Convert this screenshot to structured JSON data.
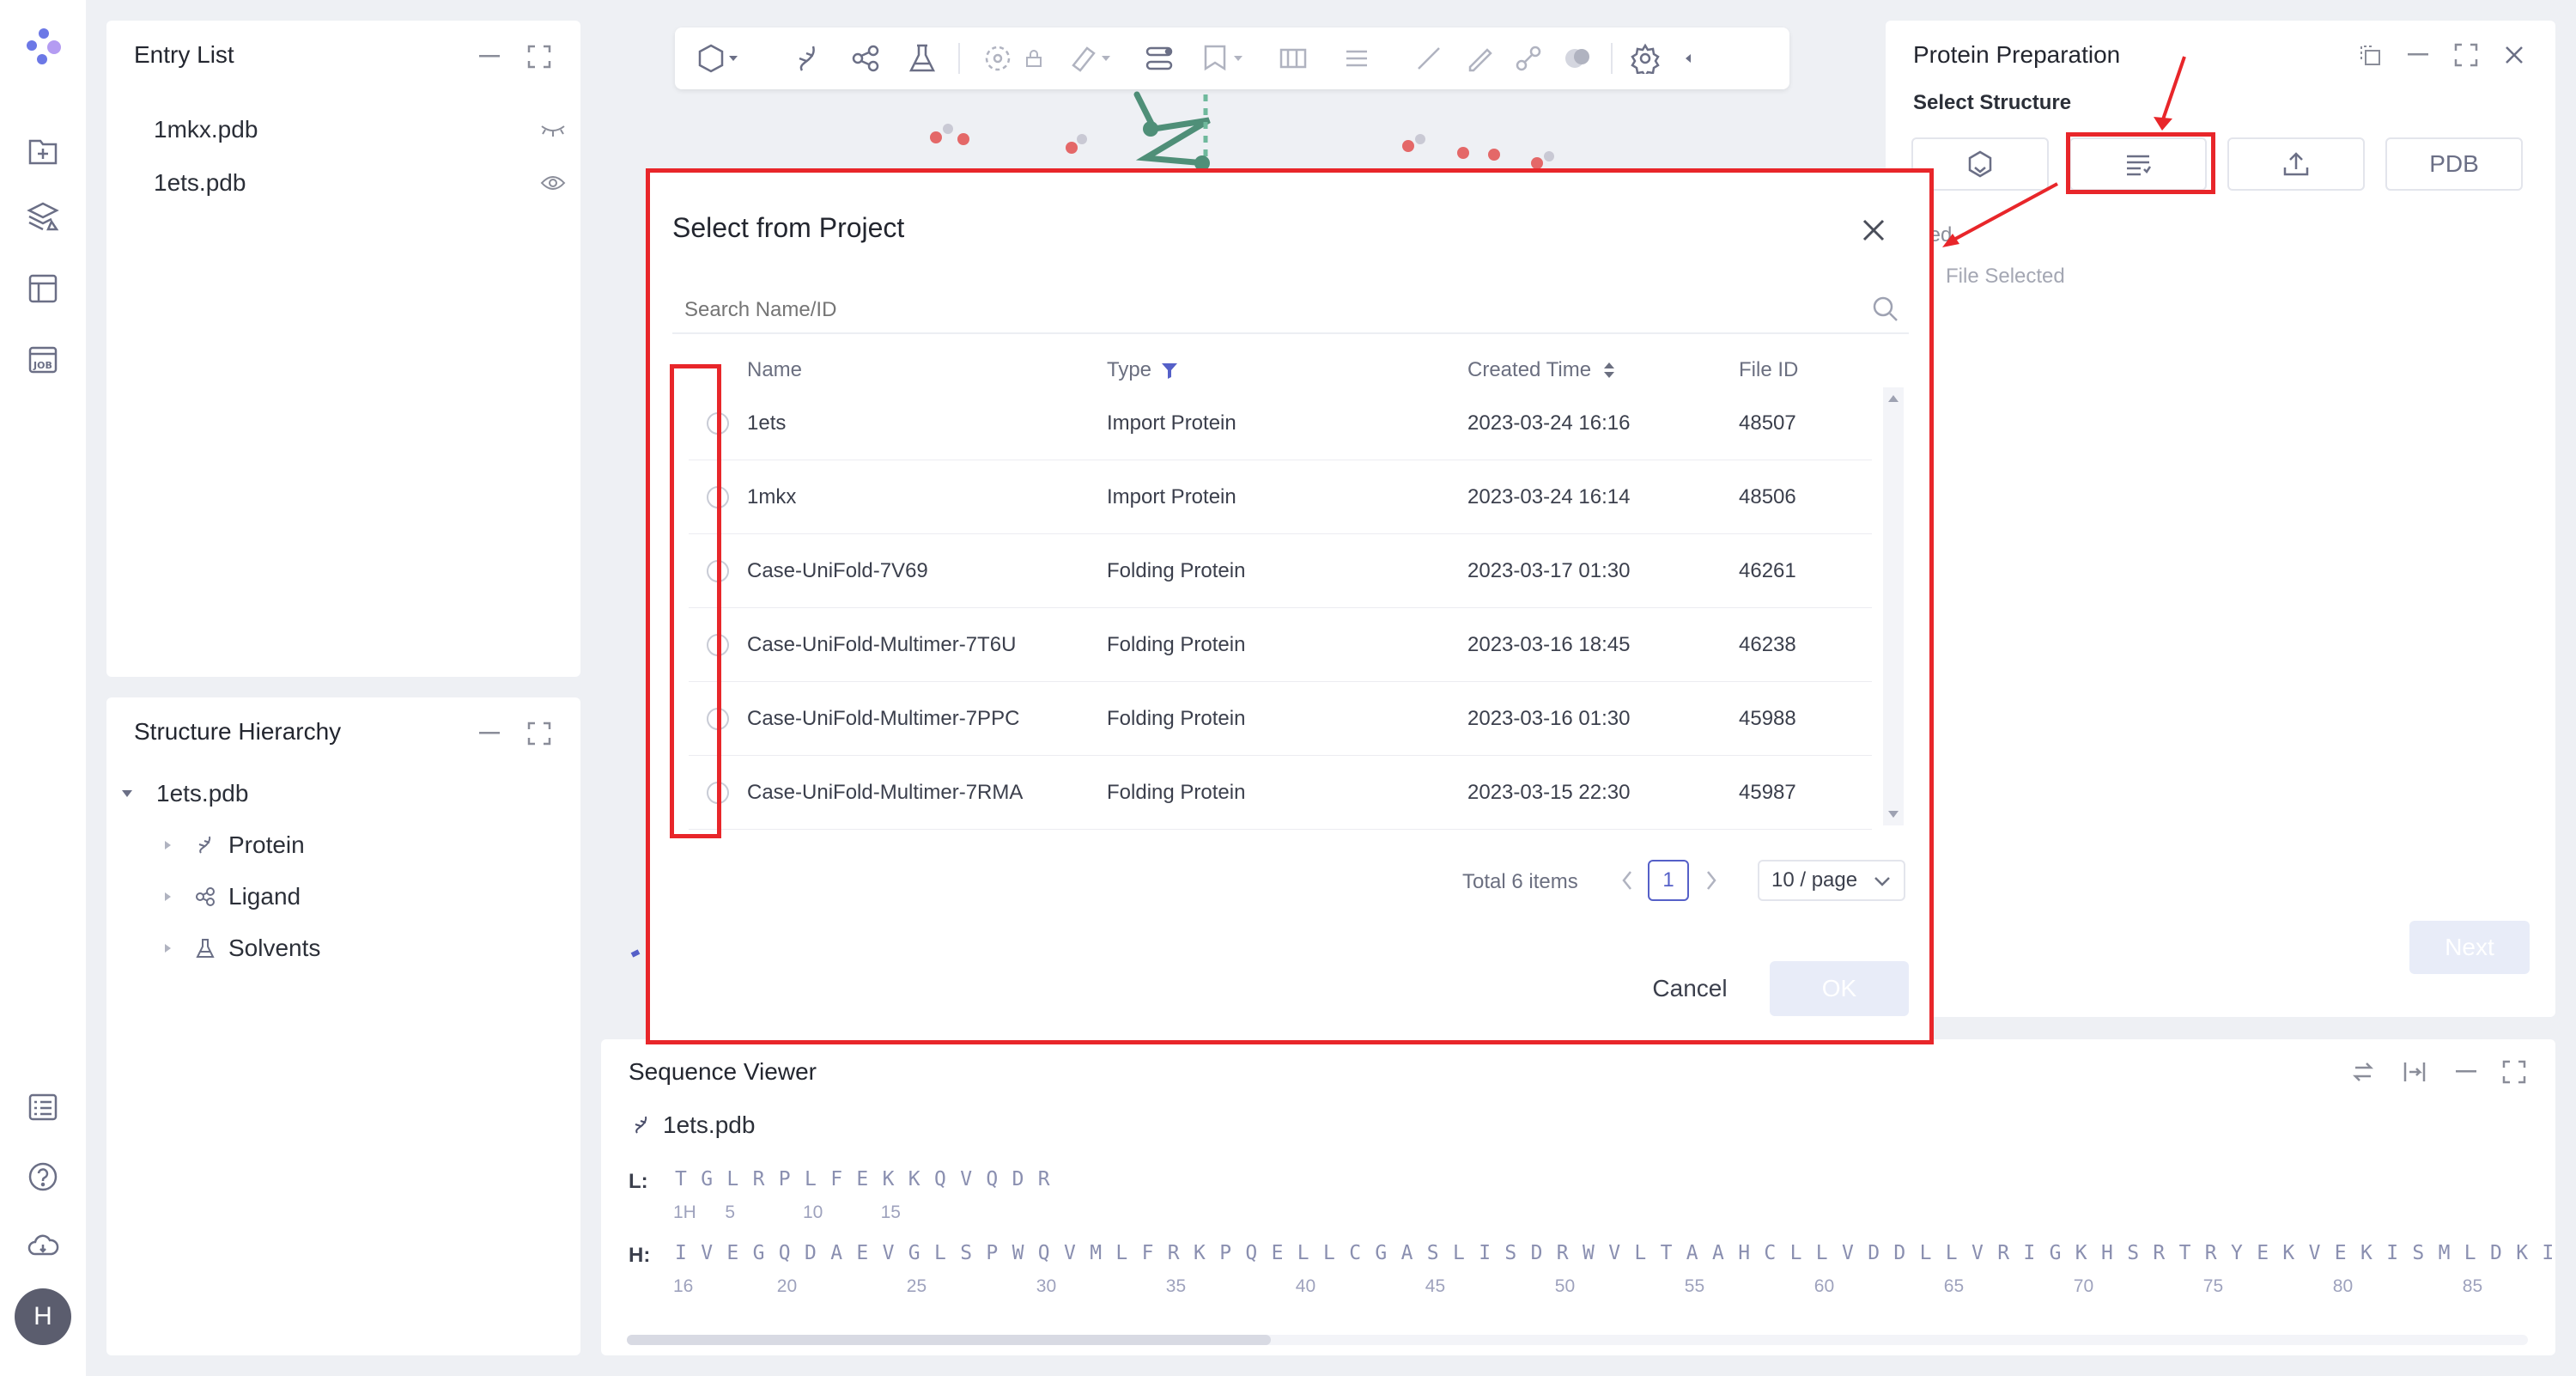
{
  "rail": {
    "icons": [
      "logo-icon",
      "new-file-icon",
      "layers-icon",
      "table-icon",
      "job-icon",
      "list-icon",
      "help-icon",
      "cloud-icon"
    ],
    "avatar": "H"
  },
  "entry_list": {
    "title": "Entry List",
    "items": [
      {
        "name": "1mkx.pdb",
        "visibility": "hidden"
      },
      {
        "name": "1ets.pdb",
        "visibility": "visible"
      }
    ]
  },
  "structure_hierarchy": {
    "title": "Structure Hierarchy",
    "root": "1ets.pdb",
    "children": [
      "Protein",
      "Ligand",
      "Solvents"
    ]
  },
  "protein_preparation": {
    "title": "Protein Preparation",
    "select_structure_label": "Select Structure",
    "source_buttons": [
      "draw-structure",
      "select-from-project",
      "upload",
      "PDB"
    ],
    "pdb_label": "PDB",
    "selected_label": "cted",
    "no_file_label": "File Selected",
    "next_label": "Next"
  },
  "modal": {
    "title": "Select from Project",
    "search_placeholder": "Search Name/ID",
    "columns": {
      "name": "Name",
      "type": "Type",
      "created": "Created Time",
      "file_id": "File ID"
    },
    "rows": [
      {
        "name": "1ets",
        "type": "Import Protein",
        "created": "2023-03-24 16:16",
        "file_id": "48507"
      },
      {
        "name": "1mkx",
        "type": "Import Protein",
        "created": "2023-03-24 16:14",
        "file_id": "48506"
      },
      {
        "name": "Case-UniFold-7V69",
        "type": "Folding Protein",
        "created": "2023-03-17 01:30",
        "file_id": "46261"
      },
      {
        "name": "Case-UniFold-Multimer-7T6U",
        "type": "Folding Protein",
        "created": "2023-03-16 18:45",
        "file_id": "46238"
      },
      {
        "name": "Case-UniFold-Multimer-7PPC",
        "type": "Folding Protein",
        "created": "2023-03-16 01:30",
        "file_id": "45988"
      },
      {
        "name": "Case-UniFold-Multimer-7RMA",
        "type": "Folding Protein",
        "created": "2023-03-15 22:30",
        "file_id": "45987"
      }
    ],
    "pagination": {
      "total": "Total 6 items",
      "current_page": "1",
      "page_size": "10 / page"
    },
    "cancel_label": "Cancel",
    "ok_label": "OK"
  },
  "sequence_viewer": {
    "title": "Sequence Viewer",
    "file": "1ets.pdb",
    "chains": [
      {
        "label": "L:",
        "sequence": "TGLRPLFEKKQVQDR",
        "numbers": [
          "1H",
          "5",
          "10",
          "15"
        ]
      },
      {
        "label": "H:",
        "sequence": "IVEGQDAEVGLSPWQVMLFRKPQELLCGASLISDRWVLTAAHCLLVDDLLVRIGKHSRTRYEKVEKISMLDKI",
        "numbers": [
          "16",
          "20",
          "25",
          "30",
          "35",
          "40",
          "45",
          "50",
          "55",
          "60",
          "65",
          "70",
          "75",
          "80",
          "85"
        ]
      }
    ]
  },
  "colors": {
    "accent": "#5560c8",
    "annotation_red": "#e8262a",
    "viewer_bg": "#eef0f4"
  }
}
